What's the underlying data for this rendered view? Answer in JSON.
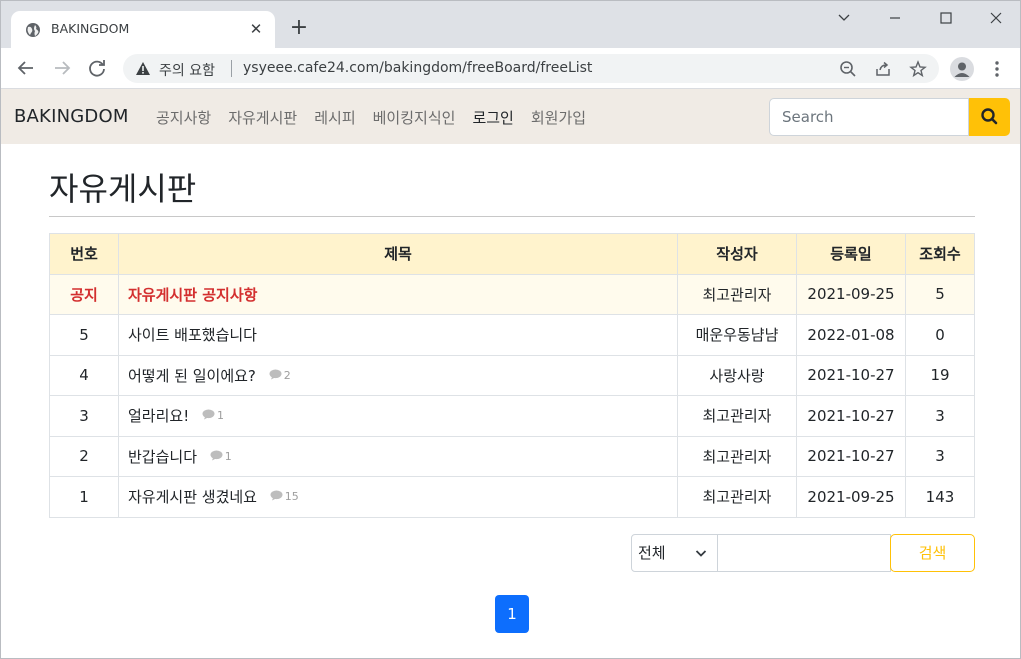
{
  "browser": {
    "tab_title": "BAKINGDOM",
    "security_warning": "주의 요함",
    "url": "ysyeee.cafe24.com/bakingdom/freeBoard/freeList"
  },
  "navbar": {
    "brand": "BAKINGDOM",
    "links": [
      "공지사항",
      "자유게시판",
      "레시피",
      "베이킹지식인",
      "로그인",
      "회원가입"
    ],
    "search_placeholder": "Search"
  },
  "page": {
    "title": "자유게시판"
  },
  "table": {
    "headers": [
      "번호",
      "제목",
      "작성자",
      "등록일",
      "조회수"
    ],
    "notice": {
      "num": "공지",
      "title": "자유게시판 공지사항",
      "writer": "최고관리자",
      "date": "2021-09-25",
      "views": "5"
    },
    "rows": [
      {
        "num": "5",
        "title": "사이트 배포했습니다",
        "comments": "",
        "writer": "매운우동냠냠",
        "date": "2022-01-08",
        "views": "0"
      },
      {
        "num": "4",
        "title": "어떻게 된 일이에요?",
        "comments": "2",
        "writer": "사랑사랑",
        "date": "2021-10-27",
        "views": "19"
      },
      {
        "num": "3",
        "title": "얼라리요!",
        "comments": "1",
        "writer": "최고관리자",
        "date": "2021-10-27",
        "views": "3"
      },
      {
        "num": "2",
        "title": "반갑습니다",
        "comments": "1",
        "writer": "최고관리자",
        "date": "2021-10-27",
        "views": "3"
      },
      {
        "num": "1",
        "title": "자유게시판 생겼네요",
        "comments": "15",
        "writer": "최고관리자",
        "date": "2021-09-25",
        "views": "143"
      }
    ]
  },
  "filter": {
    "select_value": "전체",
    "button_label": "검색"
  },
  "pagination": {
    "current": "1"
  },
  "colors": {
    "accent": "#ffc107",
    "navbar_bg": "#f0ebe5",
    "header_bg": "#fff3cd",
    "notice_text": "#d32f2f",
    "page_active": "#0d6efd"
  }
}
